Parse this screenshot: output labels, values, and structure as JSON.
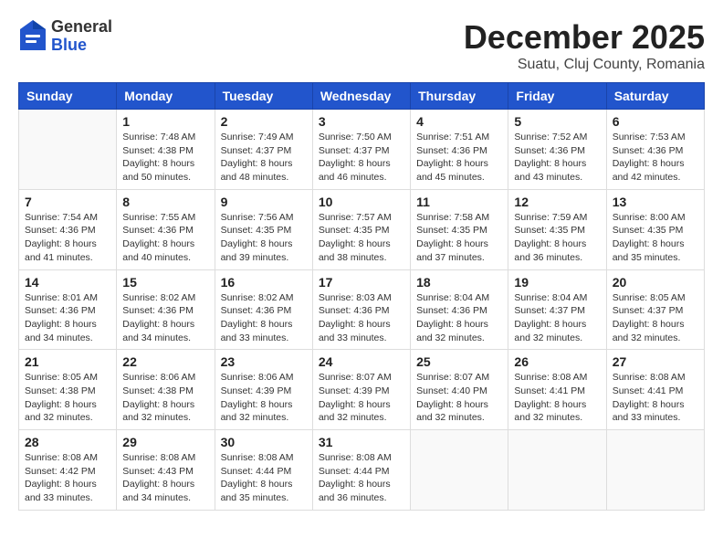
{
  "logo": {
    "general": "General",
    "blue": "Blue"
  },
  "header": {
    "month": "December 2025",
    "location": "Suatu, Cluj County, Romania"
  },
  "weekdays": [
    "Sunday",
    "Monday",
    "Tuesday",
    "Wednesday",
    "Thursday",
    "Friday",
    "Saturday"
  ],
  "weeks": [
    [
      {
        "day": null
      },
      {
        "day": 1,
        "sunrise": "7:48 AM",
        "sunset": "4:38 PM",
        "daylight": "8 hours and 50 minutes."
      },
      {
        "day": 2,
        "sunrise": "7:49 AM",
        "sunset": "4:37 PM",
        "daylight": "8 hours and 48 minutes."
      },
      {
        "day": 3,
        "sunrise": "7:50 AM",
        "sunset": "4:37 PM",
        "daylight": "8 hours and 46 minutes."
      },
      {
        "day": 4,
        "sunrise": "7:51 AM",
        "sunset": "4:36 PM",
        "daylight": "8 hours and 45 minutes."
      },
      {
        "day": 5,
        "sunrise": "7:52 AM",
        "sunset": "4:36 PM",
        "daylight": "8 hours and 43 minutes."
      },
      {
        "day": 6,
        "sunrise": "7:53 AM",
        "sunset": "4:36 PM",
        "daylight": "8 hours and 42 minutes."
      }
    ],
    [
      {
        "day": 7,
        "sunrise": "7:54 AM",
        "sunset": "4:36 PM",
        "daylight": "8 hours and 41 minutes."
      },
      {
        "day": 8,
        "sunrise": "7:55 AM",
        "sunset": "4:36 PM",
        "daylight": "8 hours and 40 minutes."
      },
      {
        "day": 9,
        "sunrise": "7:56 AM",
        "sunset": "4:35 PM",
        "daylight": "8 hours and 39 minutes."
      },
      {
        "day": 10,
        "sunrise": "7:57 AM",
        "sunset": "4:35 PM",
        "daylight": "8 hours and 38 minutes."
      },
      {
        "day": 11,
        "sunrise": "7:58 AM",
        "sunset": "4:35 PM",
        "daylight": "8 hours and 37 minutes."
      },
      {
        "day": 12,
        "sunrise": "7:59 AM",
        "sunset": "4:35 PM",
        "daylight": "8 hours and 36 minutes."
      },
      {
        "day": 13,
        "sunrise": "8:00 AM",
        "sunset": "4:35 PM",
        "daylight": "8 hours and 35 minutes."
      }
    ],
    [
      {
        "day": 14,
        "sunrise": "8:01 AM",
        "sunset": "4:36 PM",
        "daylight": "8 hours and 34 minutes."
      },
      {
        "day": 15,
        "sunrise": "8:02 AM",
        "sunset": "4:36 PM",
        "daylight": "8 hours and 34 minutes."
      },
      {
        "day": 16,
        "sunrise": "8:02 AM",
        "sunset": "4:36 PM",
        "daylight": "8 hours and 33 minutes."
      },
      {
        "day": 17,
        "sunrise": "8:03 AM",
        "sunset": "4:36 PM",
        "daylight": "8 hours and 33 minutes."
      },
      {
        "day": 18,
        "sunrise": "8:04 AM",
        "sunset": "4:36 PM",
        "daylight": "8 hours and 32 minutes."
      },
      {
        "day": 19,
        "sunrise": "8:04 AM",
        "sunset": "4:37 PM",
        "daylight": "8 hours and 32 minutes."
      },
      {
        "day": 20,
        "sunrise": "8:05 AM",
        "sunset": "4:37 PM",
        "daylight": "8 hours and 32 minutes."
      }
    ],
    [
      {
        "day": 21,
        "sunrise": "8:05 AM",
        "sunset": "4:38 PM",
        "daylight": "8 hours and 32 minutes."
      },
      {
        "day": 22,
        "sunrise": "8:06 AM",
        "sunset": "4:38 PM",
        "daylight": "8 hours and 32 minutes."
      },
      {
        "day": 23,
        "sunrise": "8:06 AM",
        "sunset": "4:39 PM",
        "daylight": "8 hours and 32 minutes."
      },
      {
        "day": 24,
        "sunrise": "8:07 AM",
        "sunset": "4:39 PM",
        "daylight": "8 hours and 32 minutes."
      },
      {
        "day": 25,
        "sunrise": "8:07 AM",
        "sunset": "4:40 PM",
        "daylight": "8 hours and 32 minutes."
      },
      {
        "day": 26,
        "sunrise": "8:08 AM",
        "sunset": "4:41 PM",
        "daylight": "8 hours and 32 minutes."
      },
      {
        "day": 27,
        "sunrise": "8:08 AM",
        "sunset": "4:41 PM",
        "daylight": "8 hours and 33 minutes."
      }
    ],
    [
      {
        "day": 28,
        "sunrise": "8:08 AM",
        "sunset": "4:42 PM",
        "daylight": "8 hours and 33 minutes."
      },
      {
        "day": 29,
        "sunrise": "8:08 AM",
        "sunset": "4:43 PM",
        "daylight": "8 hours and 34 minutes."
      },
      {
        "day": 30,
        "sunrise": "8:08 AM",
        "sunset": "4:44 PM",
        "daylight": "8 hours and 35 minutes."
      },
      {
        "day": 31,
        "sunrise": "8:08 AM",
        "sunset": "4:44 PM",
        "daylight": "8 hours and 36 minutes."
      },
      null,
      null,
      null
    ]
  ]
}
